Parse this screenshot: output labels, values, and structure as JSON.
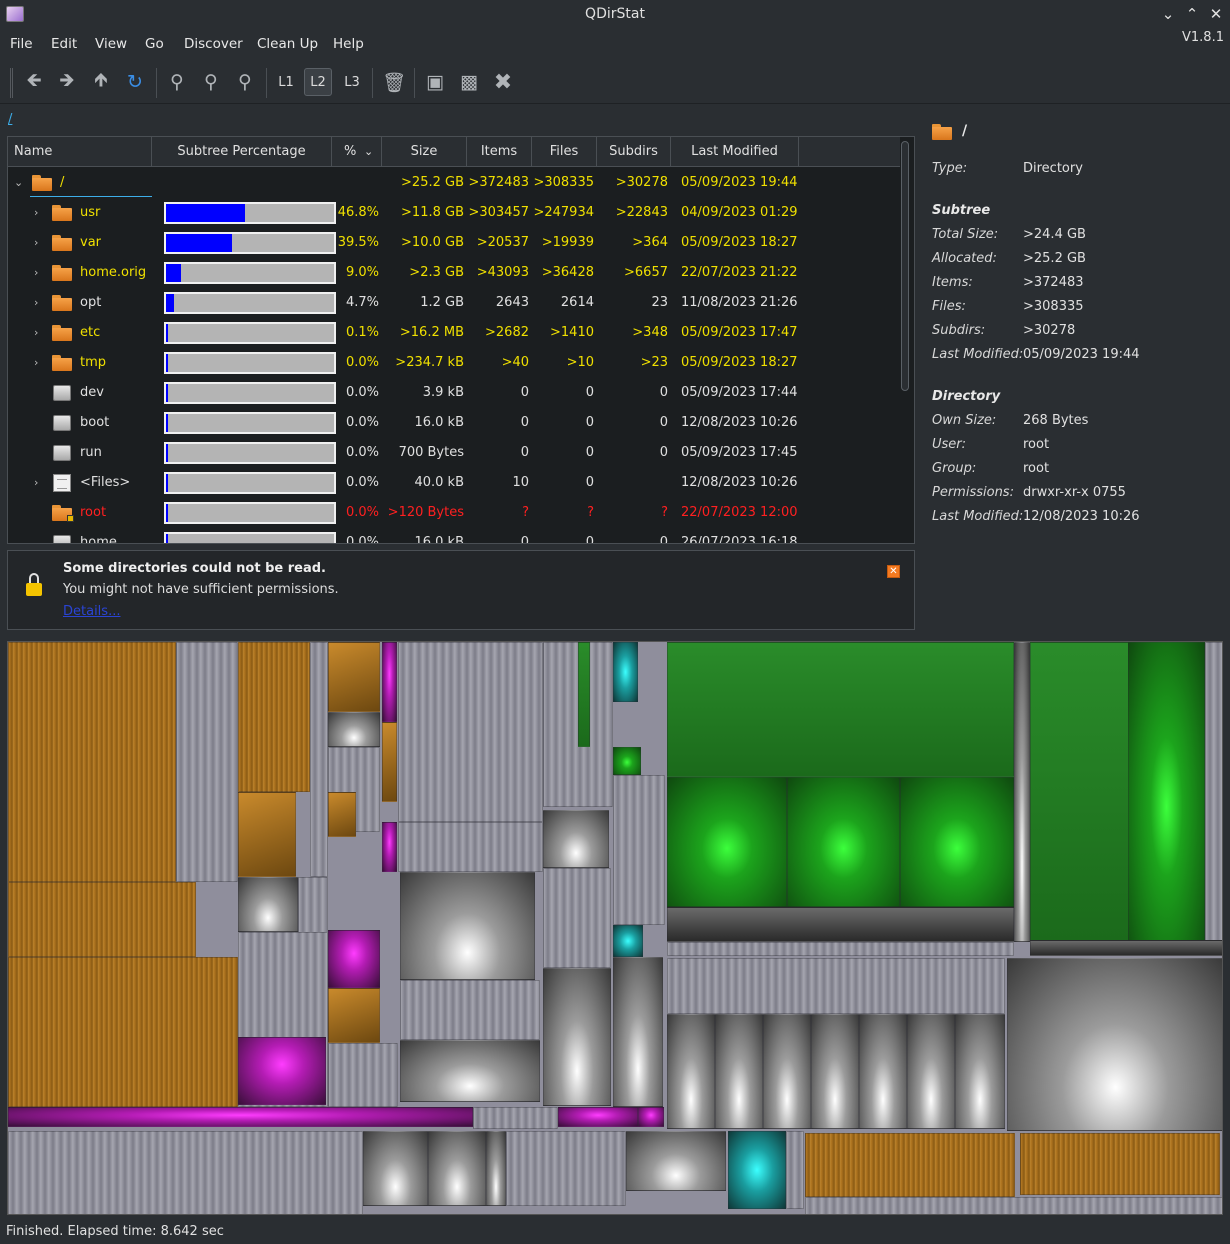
{
  "window": {
    "title": "QDirStat",
    "version": "V1.8.1"
  },
  "menu": [
    "File",
    "Edit",
    "View",
    "Go",
    "Discover",
    "Clean Up",
    "Help"
  ],
  "toolbar": {
    "levels": [
      "L1",
      "L2",
      "L3"
    ],
    "active_level": "L2",
    "icons": [
      "back-icon",
      "forward-icon",
      "up-icon",
      "refresh-icon",
      "zoom-in-icon",
      "zoom-out-icon",
      "zoom-reset-icon",
      "trash-icon",
      "open-folder-icon",
      "terminal-icon",
      "stop-icon"
    ]
  },
  "breadcrumb": "/",
  "tree": {
    "columns": [
      "Name",
      "Subtree Percentage",
      "%",
      "Size",
      "Items",
      "Files",
      "Subdirs",
      "Last Modified"
    ],
    "root": {
      "name": "/",
      "size": ">25.2 GB",
      "items": ">372483",
      "files": ">308335",
      "subdirs": ">30278",
      "modified": "05/09/2023 19:44"
    },
    "rows": [
      {
        "name": "usr",
        "icon": "folder",
        "expandable": true,
        "pct": "46.8%",
        "fraction": 0.468,
        "size": ">11.8 GB",
        "items": ">303457",
        "files": ">247934",
        "subdirs": ">22843",
        "modified": "04/09/2023 01:29",
        "color": "#f0e000"
      },
      {
        "name": "var",
        "icon": "folder",
        "expandable": true,
        "pct": "39.5%",
        "fraction": 0.395,
        "size": ">10.0 GB",
        "items": ">20537",
        "files": ">19939",
        "subdirs": ">364",
        "modified": "05/09/2023 18:27",
        "color": "#f0e000"
      },
      {
        "name": "home.orig",
        "icon": "folder",
        "expandable": true,
        "pct": "9.0%",
        "fraction": 0.09,
        "size": ">2.3 GB",
        "items": ">43093",
        "files": ">36428",
        "subdirs": ">6657",
        "modified": "22/07/2023 21:22",
        "color": "#f0e000"
      },
      {
        "name": "opt",
        "icon": "folder",
        "expandable": true,
        "pct": "4.7%",
        "fraction": 0.047,
        "size": "1.2 GB",
        "items": "2643",
        "files": "2614",
        "subdirs": "23",
        "modified": "11/08/2023 21:26",
        "color": "#e0e0e0"
      },
      {
        "name": "etc",
        "icon": "folder",
        "expandable": true,
        "pct": "0.1%",
        "fraction": 0.001,
        "size": ">16.2 MB",
        "items": ">2682",
        "files": ">1410",
        "subdirs": ">348",
        "modified": "05/09/2023 17:47",
        "color": "#f0e000"
      },
      {
        "name": "tmp",
        "icon": "folder",
        "expandable": true,
        "pct": "0.0%",
        "fraction": 0.0,
        "size": ">234.7 kB",
        "items": ">40",
        "files": ">10",
        "subdirs": ">23",
        "modified": "05/09/2023 18:27",
        "color": "#f0e000"
      },
      {
        "name": "dev",
        "icon": "disk",
        "expandable": false,
        "pct": "0.0%",
        "fraction": 0.0,
        "size": "3.9 kB",
        "items": "0",
        "files": "0",
        "subdirs": "0",
        "modified": "05/09/2023 17:44",
        "color": "#e0e0e0"
      },
      {
        "name": "boot",
        "icon": "disk",
        "expandable": false,
        "pct": "0.0%",
        "fraction": 0.0,
        "size": "16.0 kB",
        "items": "0",
        "files": "0",
        "subdirs": "0",
        "modified": "12/08/2023 10:26",
        "color": "#e0e0e0"
      },
      {
        "name": "run",
        "icon": "disk",
        "expandable": false,
        "pct": "0.0%",
        "fraction": 0.0,
        "size": "700 Bytes",
        "items": "0",
        "files": "0",
        "subdirs": "0",
        "modified": "05/09/2023 17:45",
        "color": "#e0e0e0"
      },
      {
        "name": "<Files>",
        "icon": "files",
        "expandable": true,
        "pct": "0.0%",
        "fraction": 0.0,
        "size": "40.0 kB",
        "items": "10",
        "files": "0",
        "subdirs": "",
        "modified": "12/08/2023 10:26",
        "color": "#e0e0e0"
      },
      {
        "name": "root",
        "icon": "folder-locked",
        "expandable": false,
        "pct": "0.0%",
        "fraction": 0.0,
        "size": ">120 Bytes",
        "items": "?",
        "files": "?",
        "subdirs": "?",
        "modified": "22/07/2023 12:00",
        "color": "#ff2020"
      },
      {
        "name": "home",
        "icon": "disk",
        "expandable": false,
        "pct": "0.0%",
        "fraction": 0.0,
        "size": "16.0 kB",
        "items": "0",
        "files": "0",
        "subdirs": "0",
        "modified": "26/07/2023 16:18",
        "color": "#e0e0e0"
      }
    ]
  },
  "message": {
    "title": "Some directories could not be read.",
    "text": "You might not have sufficient permissions.",
    "link": "Details..."
  },
  "details": {
    "name": "/",
    "type_label": "Type:",
    "type": "Directory",
    "subtree_heading": "Subtree",
    "subtree": [
      {
        "label": "Total Size:",
        "value": ">24.4 GB"
      },
      {
        "label": "Allocated:",
        "value": ">25.2 GB"
      },
      {
        "label": "Items:",
        "value": ">372483"
      },
      {
        "label": "Files:",
        "value": ">308335"
      },
      {
        "label": "Subdirs:",
        "value": ">30278"
      },
      {
        "label": "Last Modified:",
        "value": "05/09/2023 19:44"
      }
    ],
    "directory_heading": "Directory",
    "directory": [
      {
        "label": "Own Size:",
        "value": "268 Bytes"
      },
      {
        "label": "User:",
        "value": "root"
      },
      {
        "label": "Group:",
        "value": "root"
      },
      {
        "label": "Permissions:",
        "value": "drwxr-xr-x  0755"
      },
      {
        "label": "Last Modified:",
        "value": "12/08/2023 10:26"
      }
    ]
  },
  "status": "Finished. Elapsed time: 8.642 sec"
}
